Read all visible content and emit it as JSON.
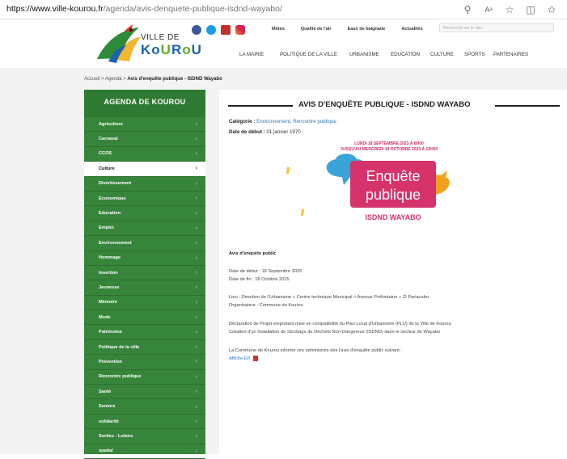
{
  "browser": {
    "url_host": "https://www.ville-kourou.fr",
    "url_path": "/agenda/avis-denquete-publique-isdnd-wayabo/"
  },
  "header": {
    "logo_line1": "VILLE DE",
    "logo_line2a": "Ko",
    "logo_line2b": "U",
    "logo_line2c": "R",
    "logo_line2d": "o",
    "logo_line2e": "U",
    "toplinks": [
      "Météo",
      "Qualité de l'air",
      "Eaux de baignade",
      "Actualités"
    ],
    "search_placeholder": "Recherche sur le site...",
    "nav": [
      "LA MAIRIE",
      "POLITIQUE DE LA VILLE",
      "URBANISME",
      "EDUCATION",
      "CULTURE",
      "SPORTS",
      "PARTENAIRES"
    ]
  },
  "breadcrumb": {
    "home": "Accueil",
    "agenda": "Agenda",
    "current": "Avis d'enquête publique - ISDND Wayabo",
    "sep": ">"
  },
  "sidebar": {
    "title": "AGENDA DE KOUROU",
    "items": [
      {
        "label": "Agriculture",
        "active": false
      },
      {
        "label": "Carnaval",
        "active": false
      },
      {
        "label": "CCOS",
        "active": false
      },
      {
        "label": "Culture",
        "active": true
      },
      {
        "label": "Divertissement",
        "active": false
      },
      {
        "label": "Economique",
        "active": false
      },
      {
        "label": "Education",
        "active": false
      },
      {
        "label": "Emploi",
        "active": false
      },
      {
        "label": "Environnement",
        "active": false
      },
      {
        "label": "Hommage",
        "active": false
      },
      {
        "label": "Insertion",
        "active": false
      },
      {
        "label": "Jeunesse",
        "active": false
      },
      {
        "label": "Mémoire",
        "active": false
      },
      {
        "label": "Mode",
        "active": false
      },
      {
        "label": "Patrimoine",
        "active": false
      },
      {
        "label": "Politique de la ville",
        "active": false
      },
      {
        "label": "Prévention",
        "active": false
      },
      {
        "label": "Rencontre publique",
        "active": false
      },
      {
        "label": "Santé",
        "active": false
      },
      {
        "label": "Seniors",
        "active": false
      },
      {
        "label": "solidarité",
        "active": false
      },
      {
        "label": "Sorties - Loisirs",
        "active": false
      },
      {
        "label": "spatial",
        "active": false
      }
    ]
  },
  "article": {
    "title": "AVIS D'ENQUÊTE PUBLIQUE - ISDND WAYABO",
    "category_label": "Catégorie :",
    "category_value": "Environnement, Rencontre publique",
    "date_label": "Date de début :",
    "date_value": "01 janvier 1970",
    "poster": {
      "dates_line1": "LUNDI 18 SEPTEMBRE 2023 À 8H00",
      "dates_line2": "JUSQU'AU MERCREDI 18 OCTOBRE 2023 À 12H00",
      "word1": "Enquête",
      "word2": "publique",
      "subtitle": "ISDND WAYABO"
    },
    "heading": "Avis d'enquête public",
    "start": "Date de début : 18 Septembre 2025",
    "end": "Date de fin : 18 Octobre 2025",
    "lieu": "Lieu : Direction de l'Urbanisme « Centre technique Municipal » Avenue Préfontaine « ZI Pariacabo",
    "organisateur": "Organisateur : Commune de Kourou",
    "declaration": "Déclaration de Projet emportant mise en compatibilité du Plan Local d'Urbanisme (PLU) de la Ville de Kourou",
    "creation": "Création d'un Installation de Stockage de Déchets Non-Dangereux (ISDND) dans le secteur de Wayabo",
    "info": "La Commune de Kourou informe ces administrés des l'avis d'enquête public suivant :",
    "pdf_link": "Affiche EP"
  }
}
